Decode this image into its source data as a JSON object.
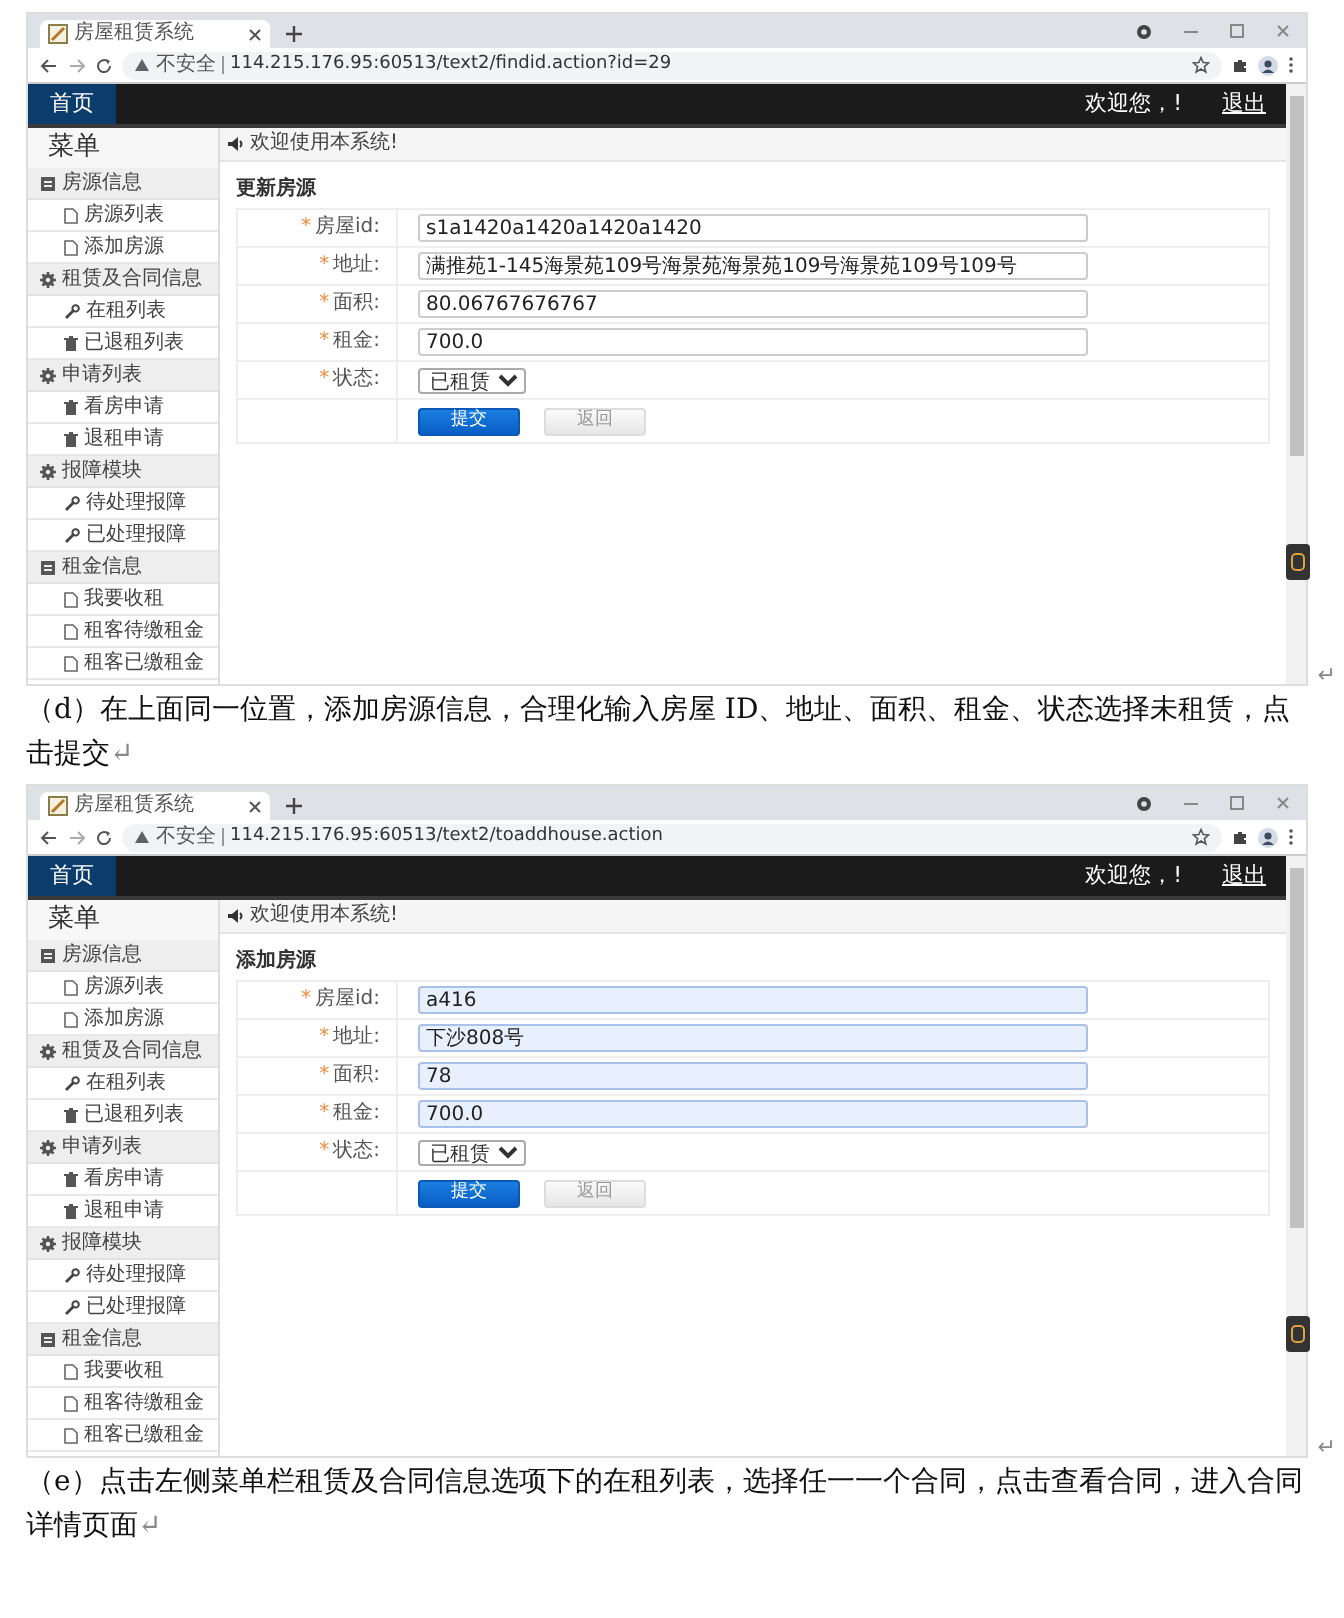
{
  "screenshots": [
    {
      "tab_title": "房屋租赁系统",
      "security_label": "不安全",
      "url": "114.215.176.95:60513/text2/findid.action?id=29",
      "nav": {
        "home": "首页",
        "welcome": "欢迎您，!",
        "logout": "退出"
      },
      "menu_title": "菜单",
      "menu": [
        {
          "label": "房源信息",
          "kind": "panel",
          "children": [
            {
              "label": "房源列表",
              "kind": "page"
            },
            {
              "label": "添加房源",
              "kind": "page"
            }
          ]
        },
        {
          "label": "租赁及合同信息",
          "kind": "gear",
          "children": [
            {
              "label": "在租列表",
              "kind": "tool"
            },
            {
              "label": "已退租列表",
              "kind": "bin"
            }
          ]
        },
        {
          "label": "申请列表",
          "kind": "gear",
          "children": [
            {
              "label": "看房申请",
              "kind": "bin"
            },
            {
              "label": "退租申请",
              "kind": "bin"
            }
          ]
        },
        {
          "label": "报障模块",
          "kind": "gear",
          "children": [
            {
              "label": "待处理报障",
              "kind": "tool"
            },
            {
              "label": "已处理报障",
              "kind": "tool"
            }
          ]
        },
        {
          "label": "租金信息",
          "kind": "panel",
          "children": [
            {
              "label": "我要收租",
              "kind": "page"
            },
            {
              "label": "租客待缴租金",
              "kind": "page"
            },
            {
              "label": "租客已缴租金",
              "kind": "page"
            }
          ]
        }
      ],
      "notice": "欢迎使用本系统!",
      "form_title": "更新房源",
      "fields": [
        {
          "mark": "*",
          "label": "房屋id:",
          "kind": "text",
          "value": "s1a1420a1420a1420a1420",
          "autofilled": false
        },
        {
          "mark": "*",
          "label": "地址:",
          "kind": "text",
          "value": "满推苑1-145海景苑109号海景苑海景苑109号海景苑109号109号",
          "autofilled": false
        },
        {
          "mark": "*",
          "label": "面积:",
          "kind": "text",
          "value": "80.06767676767",
          "autofilled": false
        },
        {
          "mark": "*",
          "label": "租金:",
          "kind": "text",
          "value": "700.0",
          "autofilled": false
        },
        {
          "mark": "*",
          "label": "状态:",
          "kind": "select",
          "value": "已租赁"
        }
      ],
      "buttons": [
        {
          "label": "提交",
          "kind": "primary"
        },
        {
          "label": "返回",
          "kind": "secondary"
        }
      ],
      "end_mark": "↵",
      "caption": "（d）在上面同一位置，添加房源信息，合理化输入房屋 ID、地址、面积、租金、状态选择未租赁，点击提交",
      "caption_mark": "↵"
    },
    {
      "tab_title": "房屋租赁系统",
      "security_label": "不安全",
      "url": "114.215.176.95:60513/text2/toaddhouse.action",
      "nav": {
        "home": "首页",
        "welcome": "欢迎您，!",
        "logout": "退出"
      },
      "menu_title": "菜单",
      "menu": [
        {
          "label": "房源信息",
          "kind": "panel",
          "children": [
            {
              "label": "房源列表",
              "kind": "page"
            },
            {
              "label": "添加房源",
              "kind": "page"
            }
          ]
        },
        {
          "label": "租赁及合同信息",
          "kind": "gear",
          "children": [
            {
              "label": "在租列表",
              "kind": "tool"
            },
            {
              "label": "已退租列表",
              "kind": "bin"
            }
          ]
        },
        {
          "label": "申请列表",
          "kind": "gear",
          "children": [
            {
              "label": "看房申请",
              "kind": "bin"
            },
            {
              "label": "退租申请",
              "kind": "bin"
            }
          ]
        },
        {
          "label": "报障模块",
          "kind": "gear",
          "children": [
            {
              "label": "待处理报障",
              "kind": "tool"
            },
            {
              "label": "已处理报障",
              "kind": "tool"
            }
          ]
        },
        {
          "label": "租金信息",
          "kind": "panel",
          "children": [
            {
              "label": "我要收租",
              "kind": "page"
            },
            {
              "label": "租客待缴租金",
              "kind": "page"
            },
            {
              "label": "租客已缴租金",
              "kind": "page"
            }
          ]
        }
      ],
      "notice": "欢迎使用本系统!",
      "form_title": "添加房源",
      "fields": [
        {
          "mark": "*",
          "label": "房屋id:",
          "kind": "text",
          "value": "a416",
          "autofilled": true
        },
        {
          "mark": "*",
          "label": "地址:",
          "kind": "text",
          "value": "下沙808号",
          "autofilled": true
        },
        {
          "mark": "*",
          "label": "面积:",
          "kind": "text",
          "value": "78",
          "autofilled": true
        },
        {
          "mark": "*",
          "label": "租金:",
          "kind": "text",
          "value": "700.0",
          "autofilled": true
        },
        {
          "mark": "*",
          "label": "状态:",
          "kind": "select",
          "value": "已租赁"
        }
      ],
      "buttons": [
        {
          "label": "提交",
          "kind": "primary"
        },
        {
          "label": "返回",
          "kind": "secondary"
        }
      ],
      "end_mark": "↵",
      "caption": "（e）点击左侧菜单栏租赁及合同信息选项下的在租列表，选择任一一个合同，点击查看合同，进入合同详情页面",
      "caption_mark": "↵"
    }
  ]
}
